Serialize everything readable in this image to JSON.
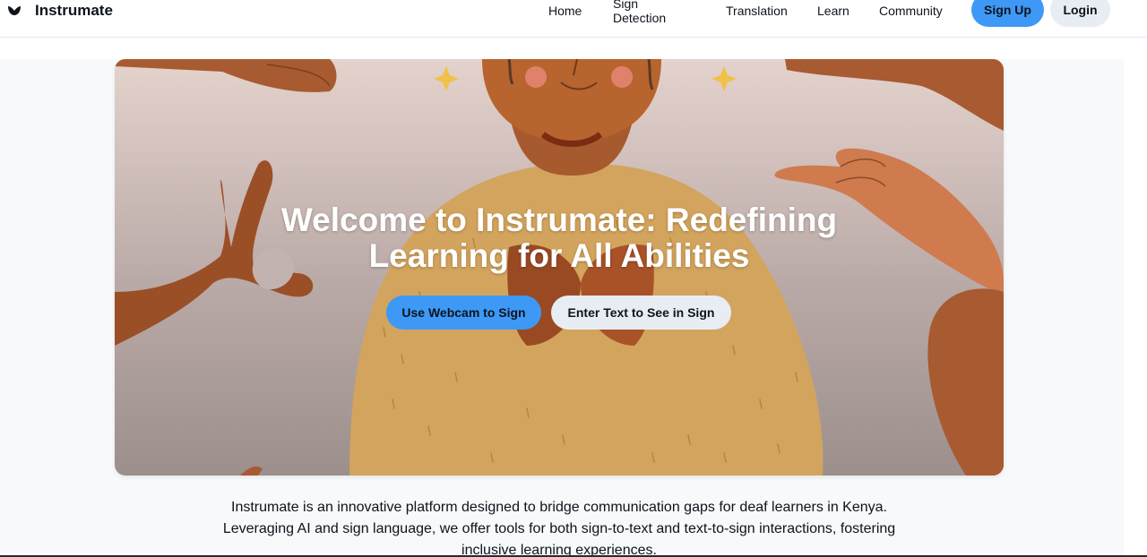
{
  "header": {
    "brand": "Instrumate",
    "logo_icon": "lotus-logo-icon",
    "nav": [
      {
        "label": "Home"
      },
      {
        "label": "Sign Detection"
      },
      {
        "label": "Translation"
      },
      {
        "label": "Learn"
      },
      {
        "label": "Community"
      }
    ],
    "signup_label": "Sign Up",
    "login_label": "Login"
  },
  "hero": {
    "title_line1": "Welcome to Instrumate: Redefining",
    "title_line2": "Learning for All Abilities",
    "primary_button": "Use Webcam to Sign",
    "secondary_button": "Enter Text to See in Sign"
  },
  "intro": {
    "line1": "Instrumate is an innovative platform designed to bridge communication gaps for deaf learners in Kenya.",
    "line2": "Leveraging AI and sign language, we offer tools for both sign-to-text and text-to-sign interactions, fostering",
    "line3": "inclusive learning experiences."
  },
  "colors": {
    "accent": "#3d99f5",
    "secondary_button": "#e7edf3",
    "text": "#0d141c"
  }
}
